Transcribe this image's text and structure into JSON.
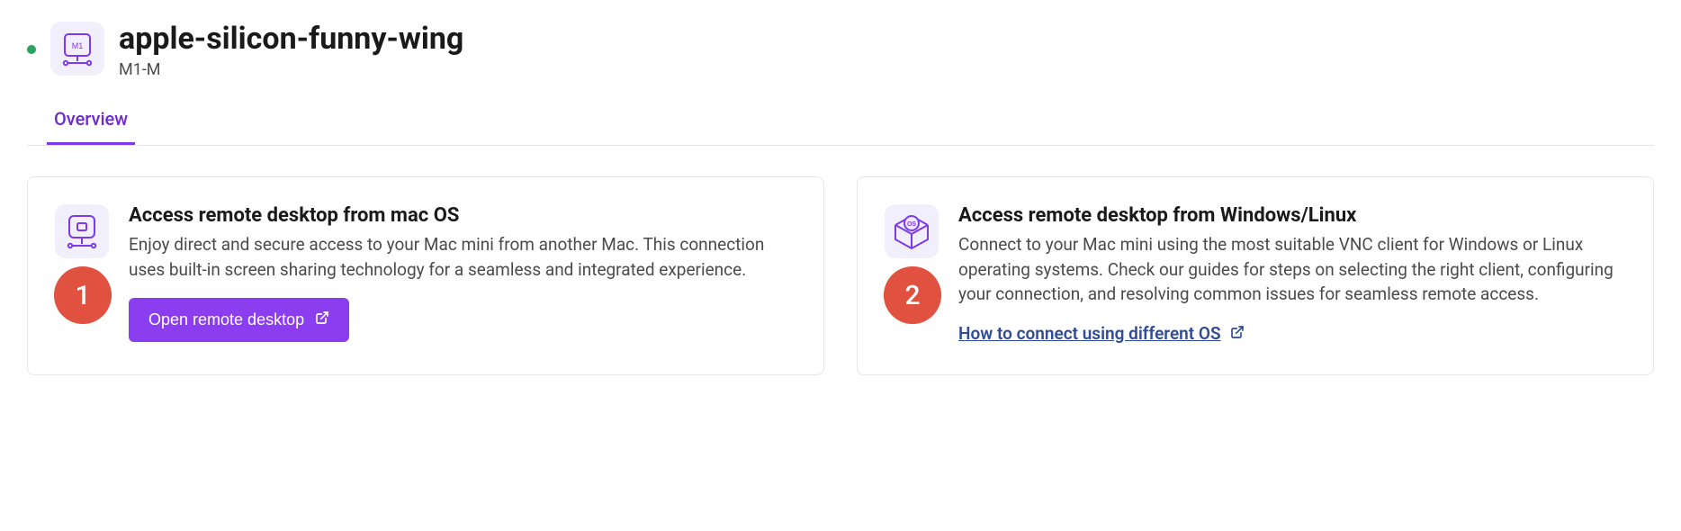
{
  "header": {
    "status": "online",
    "title": "apple-silicon-funny-wing",
    "subtitle": "M1-M",
    "icon_label": "M1"
  },
  "tabs": {
    "active": "Overview"
  },
  "cards": {
    "mac": {
      "badge": "1",
      "title": "Access remote desktop from mac OS",
      "desc": "Enjoy direct and secure access to your Mac mini from another Mac. This connection uses built-in screen sharing technology for a seamless and integrated experience.",
      "button_label": "Open remote desktop"
    },
    "other": {
      "badge": "2",
      "title": "Access remote desktop from Windows/Linux",
      "desc": "Connect to your Mac mini using the most suitable VNC client for Windows or Linux operating systems. Check our guides for steps on selecting the right client, configuring your connection, and resolving common issues for seamless remote access.",
      "link_label": "How to connect using different OS",
      "os_label": "OS"
    }
  }
}
